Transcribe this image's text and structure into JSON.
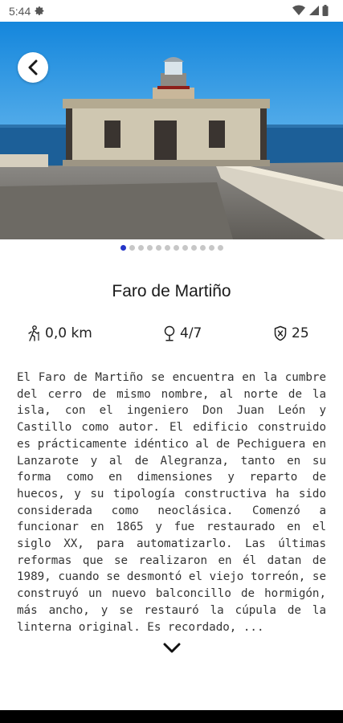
{
  "status_bar": {
    "time": "5:44",
    "icons": [
      "gear-icon",
      "wifi-icon",
      "signal-icon",
      "battery-icon"
    ]
  },
  "hero": {
    "back_icon": "chevron-left-icon",
    "carousel_total": 12,
    "carousel_active_index": 0
  },
  "place": {
    "title": "Faro de Martiño",
    "distance": "0,0 km",
    "stops": "4/7",
    "points": "25",
    "description": "El Faro de Martiño se encuentra en la cumbre del cerro de mismo nombre, al norte de la isla, con el ingeniero Don Juan León y Castillo como autor. El edificio construido es prácticamente idéntico al de Pechiguera en Lanzarote y al de Alegranza, tanto en su forma como en dimensiones y reparto de huecos, y su tipología constructiva ha sido considerada como neoclásica. Comenzó a funcionar en 1865 y fue restaurado en el siglo XX, para automatizarlo. Las últimas reformas que se realizaron en él datan de 1989, cuando se desmontó el viejo torreón, se construyó un nuevo balconcillo de hormigón, más ancho, y se restauró la cúpula de la linterna original. Es recordado, ..."
  },
  "icons": {
    "distance": "hiker-icon",
    "stops": "location-pin-icon",
    "points": "badge-icon",
    "expand": "chevron-down-icon"
  },
  "colors": {
    "accent": "#2535c8",
    "dot_inactive": "#c7c7c7"
  }
}
